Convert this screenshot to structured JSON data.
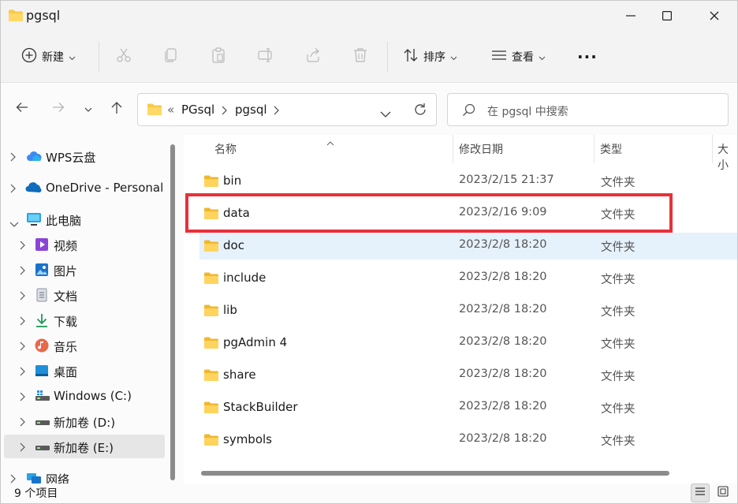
{
  "window": {
    "title": "pgsql"
  },
  "toolbar": {
    "new_label": "新建",
    "sort_label": "排序",
    "view_label": "查看",
    "more_label": "···"
  },
  "address": {
    "overflow": "«",
    "crumbs": [
      "PGsql",
      "pgsql"
    ]
  },
  "search": {
    "placeholder": "在 pgsql 中搜索"
  },
  "sidebar": {
    "items": [
      {
        "label": "WPS云盘",
        "icon": "cloud-icon"
      },
      {
        "label": "OneDrive - Personal",
        "icon": "onedrive-icon"
      },
      {
        "label": "此电脑",
        "icon": "computer-icon"
      },
      {
        "label": "视频",
        "icon": "video-icon"
      },
      {
        "label": "图片",
        "icon": "pictures-icon"
      },
      {
        "label": "文档",
        "icon": "documents-icon"
      },
      {
        "label": "下载",
        "icon": "download-icon"
      },
      {
        "label": "音乐",
        "icon": "music-icon"
      },
      {
        "label": "桌面",
        "icon": "desktop-icon"
      },
      {
        "label": "Windows (C:)",
        "icon": "drive-c-icon"
      },
      {
        "label": "新加卷 (D:)",
        "icon": "drive-icon"
      },
      {
        "label": "新加卷 (E:)",
        "icon": "drive-icon"
      },
      {
        "label": "网络",
        "icon": "network-icon"
      }
    ]
  },
  "columns": {
    "name": "名称",
    "modified": "修改日期",
    "type": "类型",
    "size": "大小"
  },
  "files": [
    {
      "name": "bin",
      "modified": "2023/2/15 21:37",
      "type": "文件夹"
    },
    {
      "name": "data",
      "modified": "2023/2/16 9:09",
      "type": "文件夹"
    },
    {
      "name": "doc",
      "modified": "2023/2/8 18:20",
      "type": "文件夹"
    },
    {
      "name": "include",
      "modified": "2023/2/8 18:20",
      "type": "文件夹"
    },
    {
      "name": "lib",
      "modified": "2023/2/8 18:20",
      "type": "文件夹"
    },
    {
      "name": "pgAdmin 4",
      "modified": "2023/2/8 18:20",
      "type": "文件夹"
    },
    {
      "name": "share",
      "modified": "2023/2/8 18:20",
      "type": "文件夹"
    },
    {
      "name": "StackBuilder",
      "modified": "2023/2/8 18:20",
      "type": "文件夹"
    },
    {
      "name": "symbols",
      "modified": "2023/2/8 18:20",
      "type": "文件夹"
    }
  ],
  "status": {
    "item_count": "9 个项目"
  },
  "colors": {
    "folder": "#f8c94a",
    "hover_row": "#e5f1fb",
    "highlight": "#e8303a",
    "selected_nav": "#e6e6e6"
  }
}
